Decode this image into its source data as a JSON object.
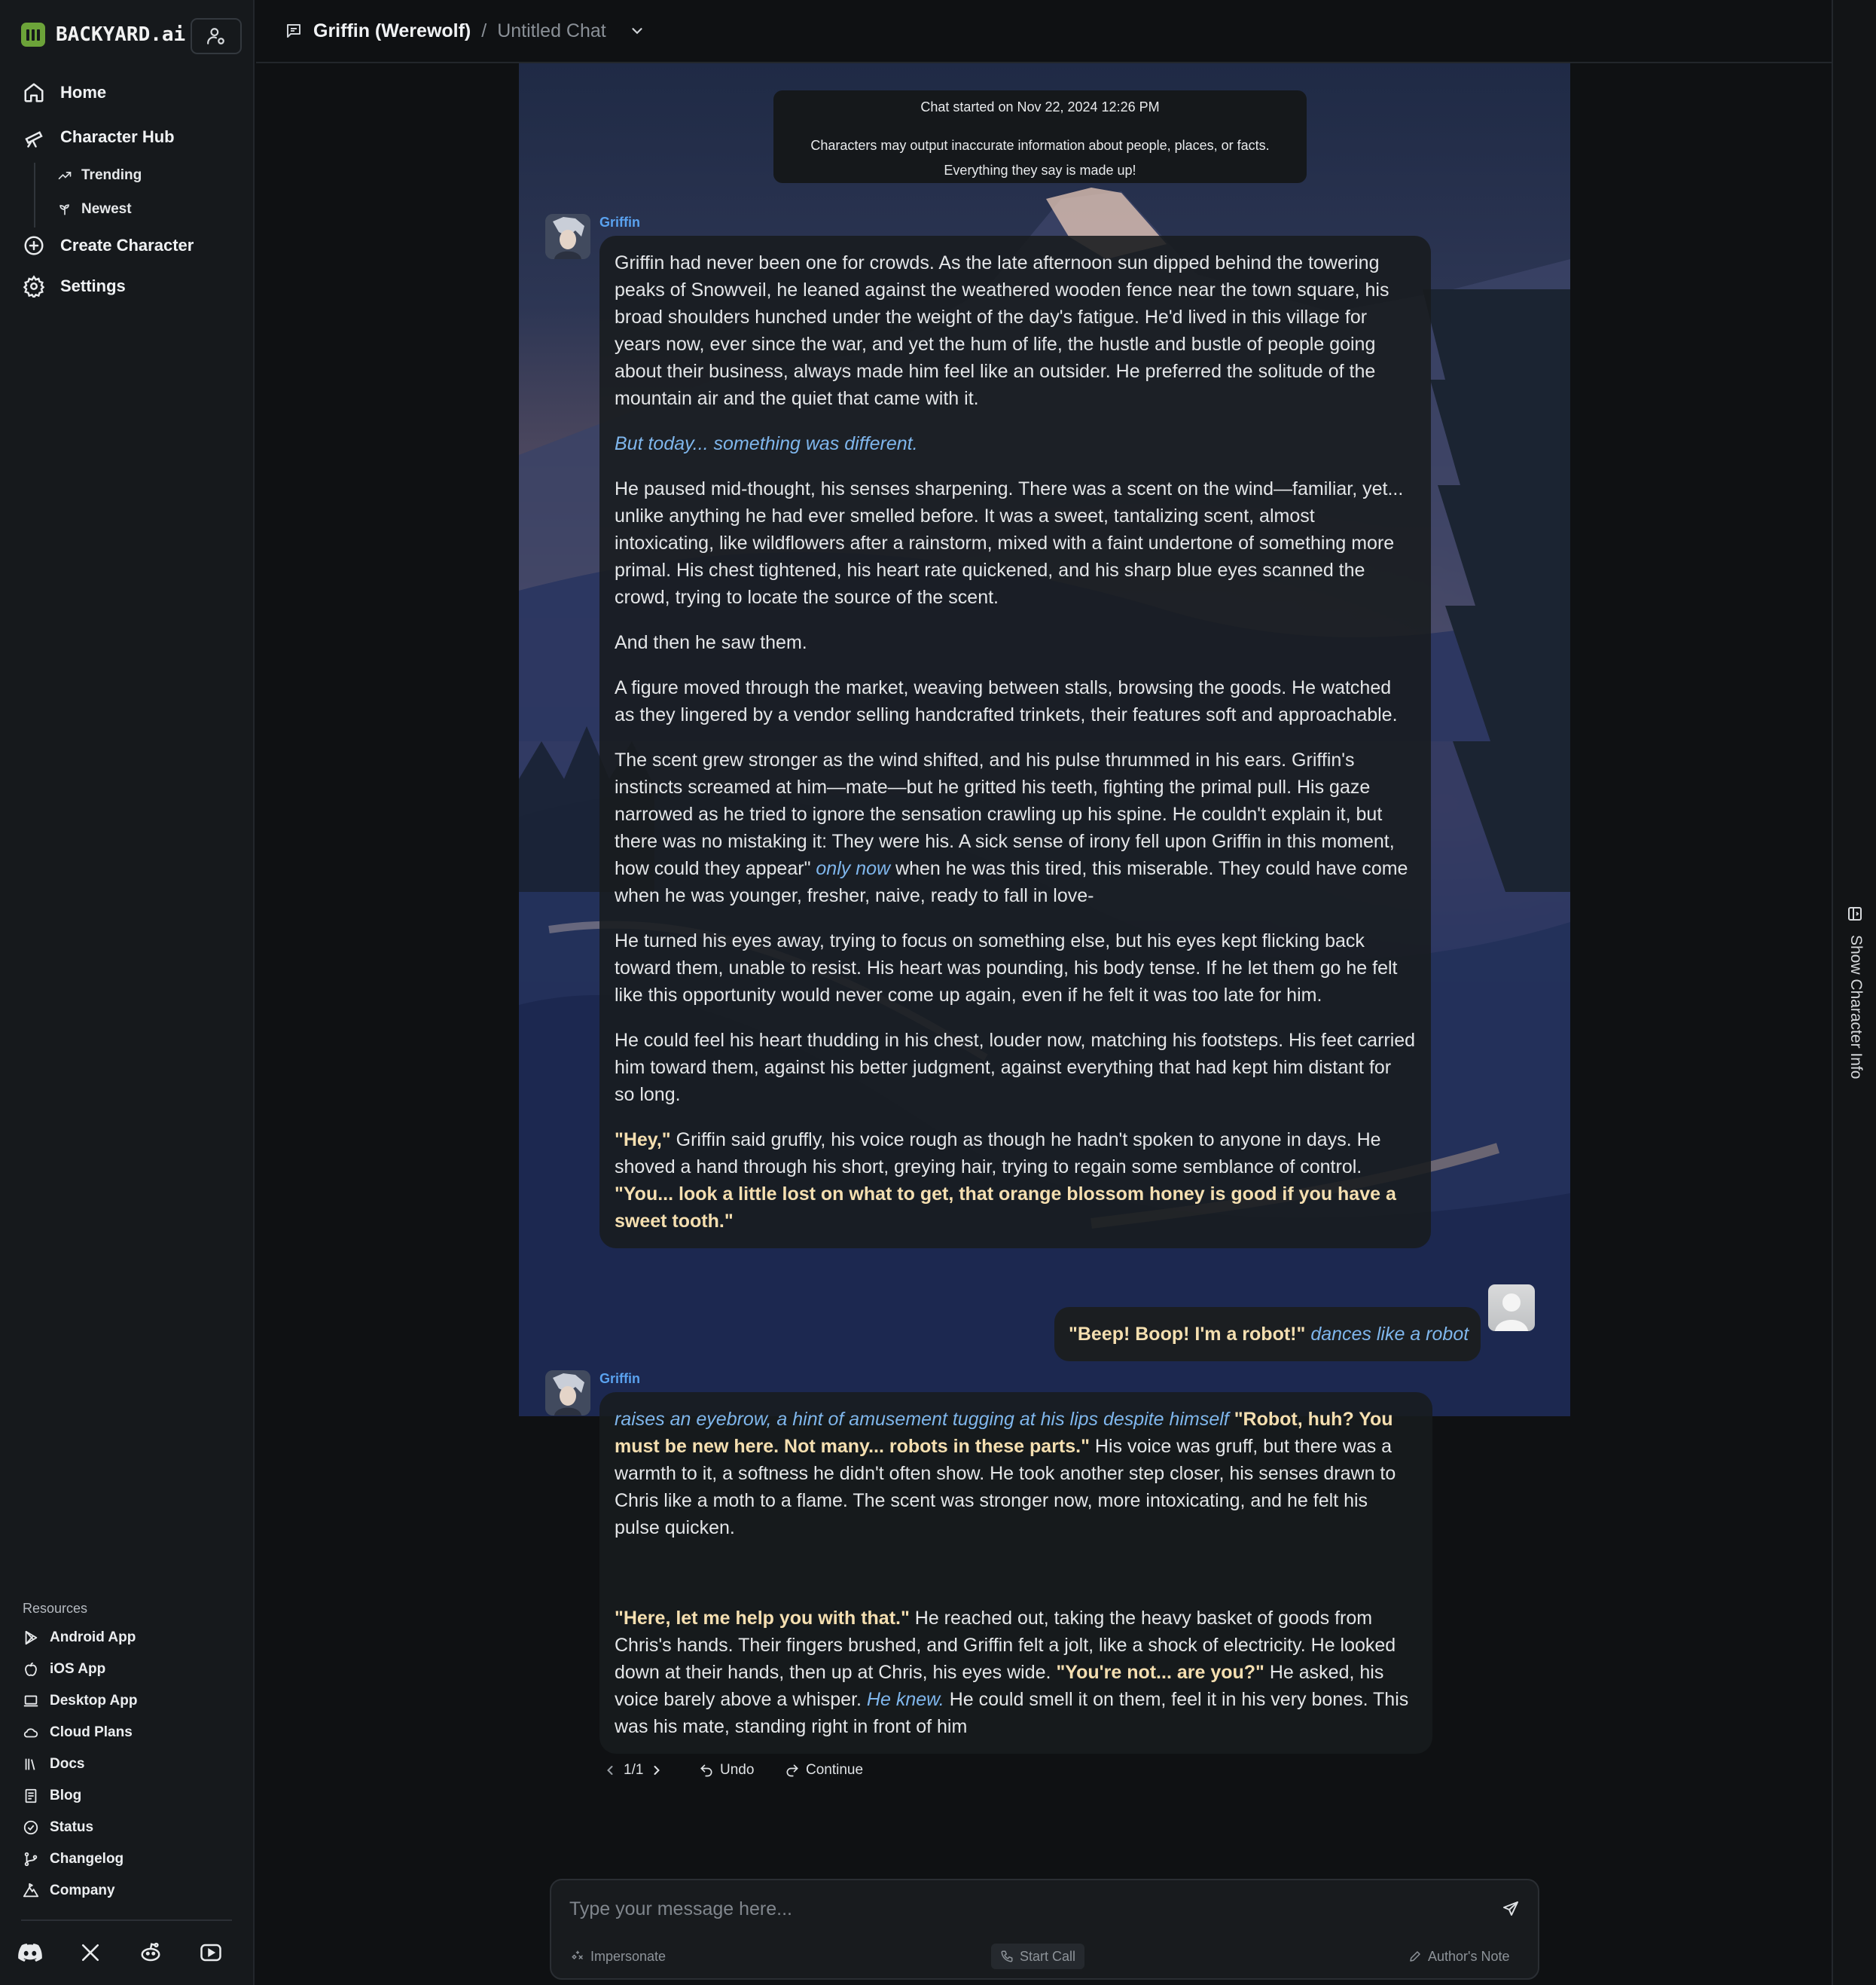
{
  "brand": {
    "name": "BACKYARD.ai"
  },
  "nav": {
    "home": "Home",
    "character_hub": "Character Hub",
    "trending": "Trending",
    "newest": "Newest",
    "create_character": "Create Character",
    "settings": "Settings"
  },
  "resources": {
    "title": "Resources",
    "items": [
      "Android App",
      "iOS App",
      "Desktop App",
      "Cloud Plans",
      "Docs",
      "Blog",
      "Status",
      "Changelog",
      "Company"
    ]
  },
  "header": {
    "character": "Griffin (Werewolf)",
    "separator": "/",
    "chat_title": "Untitled Chat"
  },
  "right_rail": {
    "label": "Show Character Info"
  },
  "notice": {
    "started": "Chat started on Nov 22, 2024 12:26 PM",
    "disclaimer_line1": "Characters may output inaccurate information about people, places, or facts.",
    "disclaimer_line2": "Everything they say is made up!"
  },
  "messages": {
    "first": {
      "speaker": "Griffin",
      "p1": "Griffin had never been one for crowds. As the late afternoon sun dipped behind the towering peaks of Snowveil, he leaned against the weathered wooden fence near the town square, his broad shoulders hunched under the weight of the day's fatigue. He'd lived in this village for years now, ever since the war, and yet the hum of life, the hustle and bustle of people going about their business, always made him feel like an outsider. He preferred the solitude of the mountain air and the quiet that came with it.",
      "p2": "But today... something was different.",
      "p3": "He paused mid-thought, his senses sharpening. There was a scent on the wind—familiar, yet... unlike anything he had ever smelled before. It was a sweet, tantalizing scent, almost intoxicating, like wildflowers after a rainstorm, mixed with a faint undertone of something more primal. His chest tightened, his heart rate quickened, and his sharp blue eyes scanned the crowd, trying to locate the source of the scent.",
      "p4": "And then he saw them.",
      "p5": "A figure moved through the market, weaving between stalls, browsing the goods. He watched as they lingered by a vendor selling handcrafted trinkets, their features soft and approachable.",
      "p6a": "The scent grew stronger as the wind shifted, and his pulse thrummed in his ears. Griffin's instincts screamed at him—mate—but he gritted his teeth, fighting the primal pull. His gaze narrowed as he tried to ignore the sensation crawling up his spine. He couldn't explain it, but there was no mistaking it: They were his. A sick sense of irony fell upon Griffin in this moment, how could they appear\"",
      "p6b": "only now",
      "p6c": "when he was this tired, this miserable. They could have come when he was younger, fresher, naive, ready to fall in love-",
      "p7": "He turned his eyes away, trying to focus on something else, but his eyes kept flicking back toward them, unable to resist. His heart was pounding, his body tense. If he let them go he felt like this opportunity would never come up again, even if he felt it was too late for him.",
      "p8": "He could feel his heart thudding in his chest, louder now, matching his footsteps. His feet carried him toward them, against his better judgment, against everything that had kept him distant for so long.",
      "p9a": "\"Hey,\"",
      "p9b": "Griffin said gruffly, his voice rough as though he hadn't spoken to anyone in days. He shoved a hand through his short, greying hair, trying to regain some semblance of control.",
      "p9c": "\"You... look a little lost on what to get, that orange blossom honey is good if you have a sweet tooth.\""
    },
    "user": {
      "speech": "\"Beep! Boop! I'm a robot!\"",
      "action": "dances like a robot"
    },
    "second": {
      "speaker": "Griffin",
      "p1a": "raises an eyebrow, a hint of amusement tugging at his lips despite himself",
      "p1b": "\"Robot, huh? You must be new here. Not many... robots in these parts.\"",
      "p1c": "His voice was gruff, but there was a warmth to it, a softness he didn't often show. He took another step closer, his senses drawn to Chris like a moth to a flame. The scent was stronger now, more intoxicating, and he felt his pulse quicken.",
      "p2a": "\"Here, let me help you with that.\"",
      "p2b": "He reached out, taking the heavy basket of goods from Chris's hands. Their fingers brushed, and Griffin felt a jolt, like a shock of electricity. He looked down at their hands, then up at Chris, his eyes wide.",
      "p2c": "\"You're not... are you?\"",
      "p2d": "He asked, his voice barely above a whisper.",
      "p2e": "He knew.",
      "p2f": "He could smell it on them, feel it in his very bones. This was his mate, standing right in front of him"
    }
  },
  "message_controls": {
    "page": "1/1",
    "undo": "Undo",
    "continue": "Continue"
  },
  "composer": {
    "placeholder": "Type your message here...",
    "impersonate": "Impersonate",
    "start_call": "Start Call",
    "authors_note": "Author's Note"
  }
}
